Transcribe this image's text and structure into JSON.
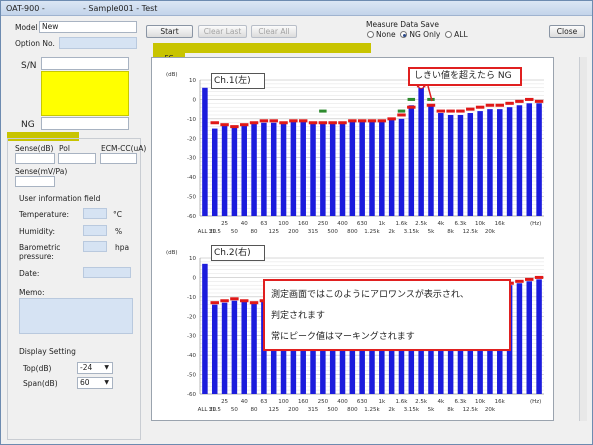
{
  "window": {
    "app": "OAT-900 -",
    "doc": "- Sample001 - Test"
  },
  "header": {
    "model_label": "Model",
    "model_value": "New",
    "option_label": "Option No.",
    "start": "Start",
    "clear_last": "Clear Last",
    "clear_all": "Clear All",
    "measure_save": "Measure Data Save",
    "opt_none": "None",
    "opt_ng": "NG Only",
    "opt_all": "ALL",
    "close": "Close"
  },
  "left": {
    "sn_label": "S/N",
    "ng_label": "NG",
    "sense_db": "Sense(dB)",
    "pol": "Pol",
    "ecm": "ECM-CC(uA)",
    "sense_mv": "Sense(mV/Pa)",
    "user_info": "User information field",
    "temperature": "Temperature:",
    "temp_unit": "°C",
    "humidity": "Humidity:",
    "hum_unit": "%",
    "baro1": "Barometric",
    "baro2": "pressure:",
    "baro_unit": "hpa",
    "date": "Date:",
    "memo": "Memo:",
    "display_setting": "Display Setting",
    "top_label": "Top(dB)",
    "top_value": "-24",
    "span_label": "Span(dB)",
    "span_value": "60"
  },
  "tab": {
    "fc": "FC"
  },
  "annotations": {
    "ch1": "Ch.1(左)",
    "ch2": "Ch.2(右)",
    "over": "しきい値を超えたら NG",
    "note1": "測定画面ではこのようにアロワンスが表示され、",
    "note2": "判定されます",
    "note3": "常にピーク値はマーキングされます"
  },
  "colors": {
    "bar": "#1c1cdc",
    "limit": "#e01818",
    "marker": "#2e8b2e",
    "accent": "#c8c400"
  },
  "chart_data": [
    {
      "type": "bar",
      "name": "Ch.1",
      "ylabel": "(dB)",
      "xunit": "(Hz)",
      "ylim": [
        -60,
        10
      ],
      "yticks": [
        10,
        0,
        -10,
        -20,
        -30,
        -40,
        -50,
        -60
      ],
      "ticks_top": [
        "25",
        "40",
        "63",
        "100",
        "160",
        "250",
        "400",
        "630",
        "1k",
        "1.6k",
        "2.5k",
        "4k",
        "6.3k",
        "10k",
        "16k"
      ],
      "ticks_bot": [
        "ALL 20",
        "31.5",
        "50",
        "80",
        "125",
        "200",
        "315",
        "500",
        "800",
        "1.25k",
        "2k",
        "3.15k",
        "5k",
        "8k",
        "12.5k",
        "20k"
      ],
      "values": [
        6,
        -15,
        -13,
        -14,
        -13,
        -12,
        -12,
        -12,
        -12,
        -11,
        -11,
        -12,
        -12,
        -12,
        -12,
        -11,
        -11,
        -11,
        -11,
        -10,
        -10,
        -3,
        7,
        -3,
        -7,
        -8,
        -8,
        -7,
        -6,
        -5,
        -5,
        -4,
        -3,
        -2,
        -2
      ],
      "limits": [
        null,
        -12,
        -13,
        -14,
        -13,
        -12,
        -11,
        -11,
        -12,
        -11,
        -11,
        -12,
        -12,
        -12,
        -12,
        -11,
        -11,
        -11,
        -11,
        -10,
        -8,
        -4,
        7,
        -3,
        -6,
        -6,
        -6,
        -5,
        -4,
        -3,
        -3,
        -2,
        -1,
        0,
        -1
      ],
      "markers": [
        null,
        null,
        null,
        null,
        null,
        null,
        null,
        null,
        null,
        null,
        null,
        null,
        -6,
        null,
        null,
        null,
        null,
        null,
        null,
        null,
        -6,
        0,
        null,
        0,
        null,
        null,
        null,
        null,
        null,
        null,
        null,
        null,
        null,
        null,
        null
      ],
      "peak_index": 22
    },
    {
      "type": "bar",
      "name": "Ch.2",
      "ylabel": "(dB)",
      "xunit": "(Hz)",
      "ylim": [
        -60,
        10
      ],
      "yticks": [
        10,
        0,
        -10,
        -20,
        -30,
        -40,
        -50,
        -60
      ],
      "ticks_top": [
        "25",
        "40",
        "63",
        "100",
        "160",
        "250",
        "400",
        "630",
        "1k",
        "1.6k",
        "2.5k",
        "4k",
        "6.3k",
        "10k",
        "16k"
      ],
      "ticks_bot": [
        "ALL 20",
        "31.5",
        "50",
        "80",
        "125",
        "200",
        "315",
        "500",
        "800",
        "1.25k",
        "2k",
        "3.15k",
        "5k",
        "8k",
        "12.5k",
        "20k"
      ],
      "values": [
        7,
        -14,
        -13,
        -12,
        -12,
        -13,
        -12,
        -12,
        -11,
        -11,
        -11,
        -11,
        -11,
        -11,
        -11,
        -11,
        -10,
        -10,
        -9,
        -9,
        -9,
        -9,
        -9,
        -9,
        -8,
        -8,
        -7,
        -6,
        -6,
        -5,
        -4,
        -4,
        -3,
        -2,
        -1
      ],
      "limits": [
        null,
        -13,
        -12,
        -11,
        -12,
        -13,
        -12,
        -11,
        -11,
        -11,
        -11,
        -11,
        -11,
        -11,
        -11,
        -11,
        -10,
        -10,
        -9,
        -9,
        -9,
        -9,
        -9,
        -9,
        -8,
        -8,
        -7,
        -6,
        -5,
        -4,
        -4,
        -3,
        -2,
        -1,
        0
      ],
      "markers": [],
      "peak_index": null
    }
  ]
}
